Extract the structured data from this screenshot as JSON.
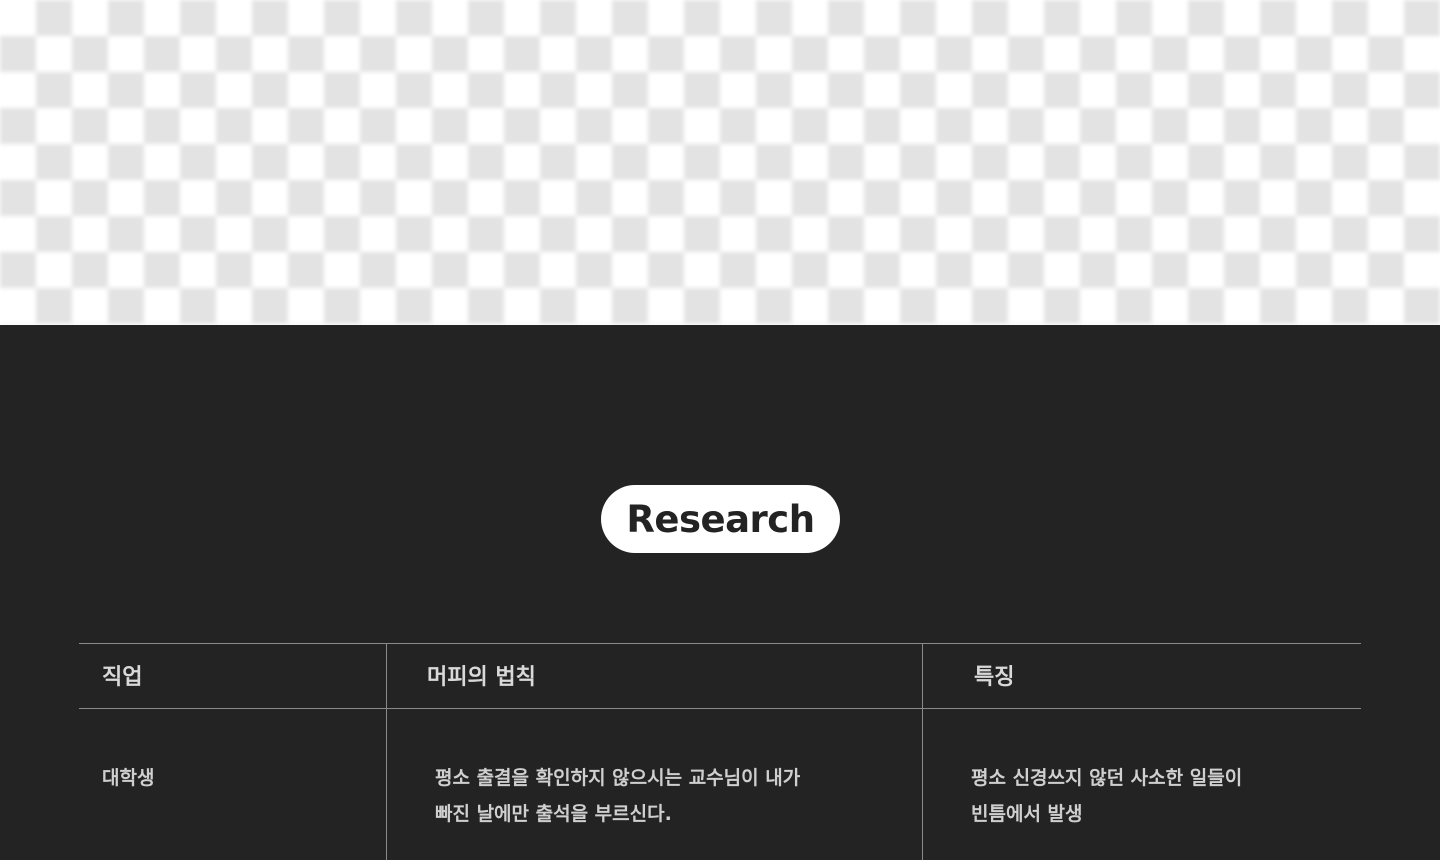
{
  "section": {
    "badge_label": "Research"
  },
  "table": {
    "headers": [
      "직업",
      "머피의 법칙",
      "특징"
    ],
    "rows": [
      {
        "job": "대학생",
        "law_lines": [
          "평소 출결을 확인하지 않으시는 교수님이 내가",
          "빠진 날에만 출석을 부르신다."
        ],
        "feature_lines": [
          "평소 신경쓰지 않던 사소한 일들이",
          "빈틈에서 발생"
        ]
      }
    ]
  },
  "colors": {
    "background": "#232323",
    "pill": "#ffffff",
    "text": "#d4d4d4",
    "rule": "#8a8a8a"
  }
}
